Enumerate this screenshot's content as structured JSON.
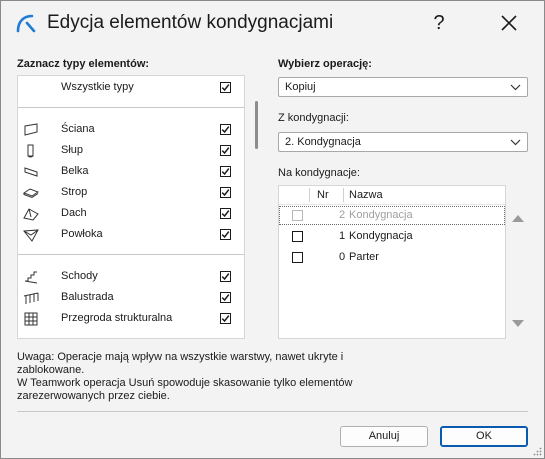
{
  "window": {
    "title": "Edycja elementów kondygnacjami",
    "help_label": "?",
    "logo_icon": "archicad-logo-icon",
    "accent_color": "#0a5ab0"
  },
  "types_section": {
    "label": "Zaznacz typy elementów:",
    "all_types": {
      "label": "Wszystkie typy",
      "checked": true
    },
    "groups": [
      [
        {
          "label": "Ściana",
          "icon": "wall-icon",
          "checked": true
        },
        {
          "label": "Słup",
          "icon": "column-icon",
          "checked": true
        },
        {
          "label": "Belka",
          "icon": "beam-icon",
          "checked": true
        },
        {
          "label": "Strop",
          "icon": "slab-icon",
          "checked": true
        },
        {
          "label": "Dach",
          "icon": "roof-icon",
          "checked": true
        },
        {
          "label": "Powłoka",
          "icon": "shell-icon",
          "checked": true
        }
      ],
      [
        {
          "label": "Schody",
          "icon": "stair-icon",
          "checked": true
        },
        {
          "label": "Balustrada",
          "icon": "railing-icon",
          "checked": true
        },
        {
          "label": "Przegroda strukturalna",
          "icon": "curtain-wall-icon",
          "checked": true
        }
      ]
    ]
  },
  "operation": {
    "label": "Wybierz operację:",
    "value": "Kopiuj"
  },
  "from_level": {
    "label": "Z kondygnacji:",
    "value": "2. Kondygnacja"
  },
  "to_levels": {
    "label": "Na kondygnacje:",
    "columns": {
      "nr": "Nr",
      "name": "Nazwa"
    },
    "rows": [
      {
        "nr": "2",
        "name": "Kondygnacja",
        "checked": false,
        "disabled": true,
        "focused": true
      },
      {
        "nr": "1",
        "name": "Kondygnacja",
        "checked": false,
        "disabled": false,
        "focused": false
      },
      {
        "nr": "0",
        "name": "Parter",
        "checked": false,
        "disabled": false,
        "focused": false
      }
    ]
  },
  "note": {
    "line1": "Uwaga: Operacje mają wpływ na wszystkie warstwy, nawet ukryte i",
    "line2": "zablokowane.",
    "line3": "W Teamwork operacja Usuń spowoduje skasowanie tylko elementów",
    "line4": "zarezerwowanych przez ciebie."
  },
  "buttons": {
    "cancel": "Anuluj",
    "ok": "OK"
  }
}
